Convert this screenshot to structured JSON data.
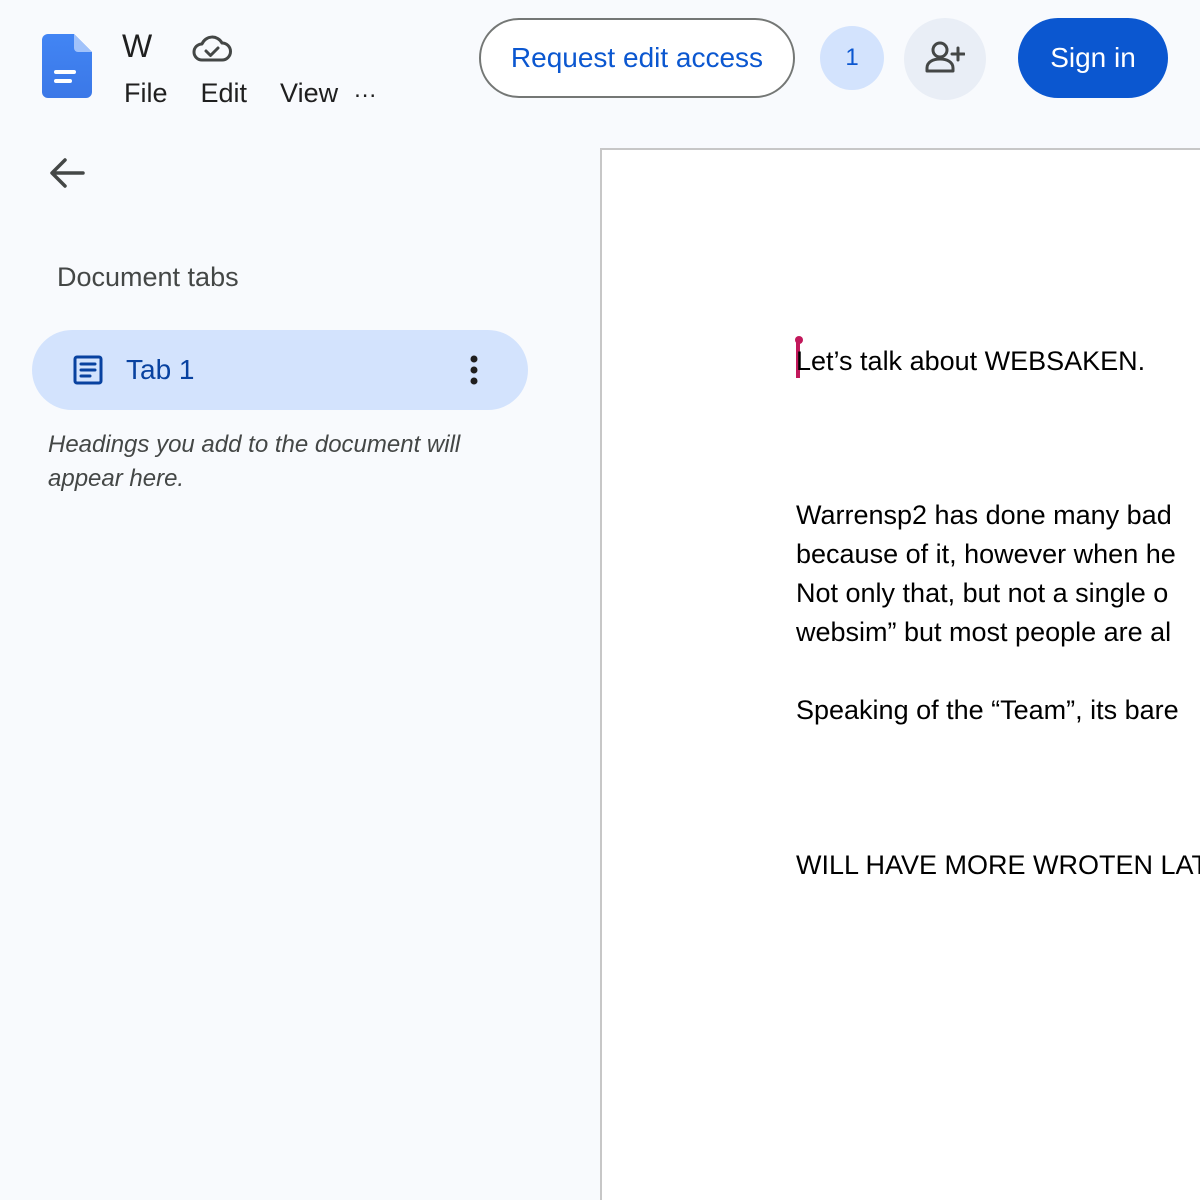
{
  "header": {
    "title": "W",
    "menu": {
      "file": "File",
      "edit": "Edit",
      "view": "View",
      "more": "..."
    },
    "request_edit_label": "Request edit access",
    "viewer_count": "1",
    "sign_in_label": "Sign in"
  },
  "sidebar": {
    "heading": "Document tabs",
    "tabs": [
      {
        "label": "Tab 1"
      }
    ],
    "hint": "Headings you add to the document will appear here."
  },
  "document": {
    "lines": [
      "Let’s talk about WEBSAKEN.",
      "Warrensp2 has done many bad",
      "because of it, however when he",
      "Not only that, but not a single o",
      "websim” but most people are al",
      "Speaking of the “Team”, its bare",
      "WILL HAVE MORE WROTEN LAT"
    ]
  },
  "colors": {
    "accent": "#0b57d0",
    "selected_tab": "#d3e3fd",
    "cursor": "#c2185b"
  },
  "icons": {
    "logo": "docs-logo-icon",
    "cloud": "cloud-done-icon",
    "share": "person-add-icon",
    "back": "arrow-back-icon",
    "tab": "document-icon",
    "tab_menu": "more-vert-icon"
  }
}
